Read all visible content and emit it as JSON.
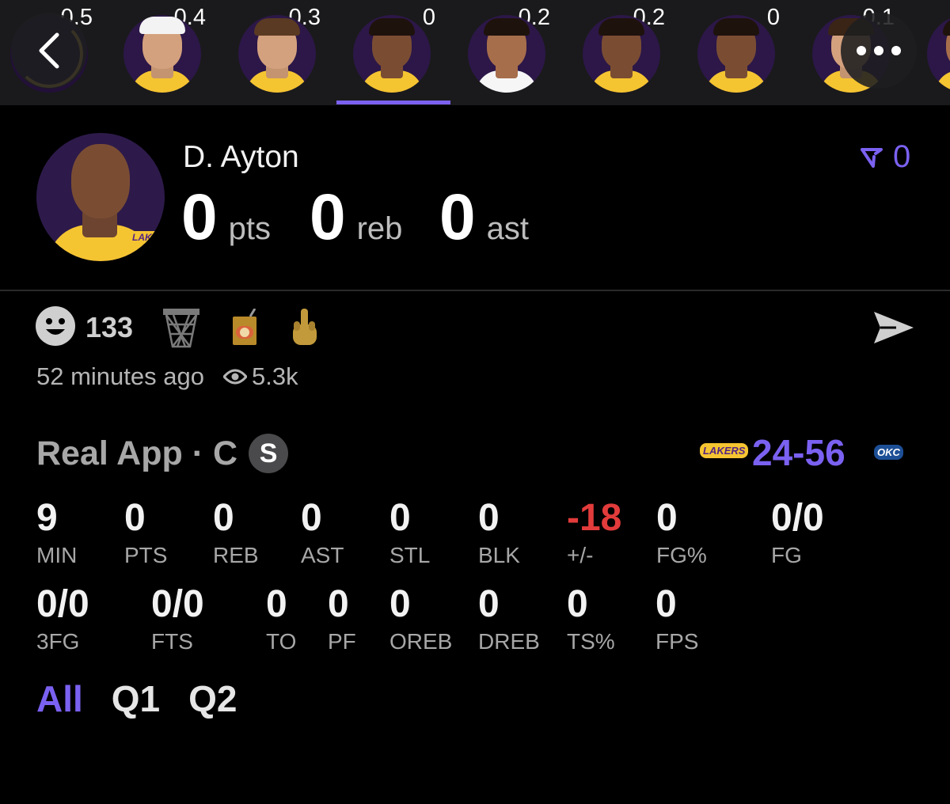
{
  "player_strip": [
    {
      "score": "0.5",
      "style": "ghost"
    },
    {
      "score": "0.4",
      "style": "hat"
    },
    {
      "score": "0.3",
      "style": "light"
    },
    {
      "score": "0",
      "style": "dark",
      "selected": true
    },
    {
      "score": "0.2",
      "style": "mid"
    },
    {
      "score": "0.2",
      "style": "dark"
    },
    {
      "score": "0",
      "style": "dark"
    },
    {
      "score": "-0.1",
      "style": "light"
    },
    {
      "score": "",
      "style": "mid"
    }
  ],
  "header": {
    "player_name": "D. Ayton",
    "pts_value": "0",
    "pts_label": "pts",
    "reb_value": "0",
    "reb_label": "reb",
    "ast_value": "0",
    "ast_label": "ast",
    "vote_count": "0",
    "avatar_logo": "LAKERS"
  },
  "reactions": {
    "count": "133",
    "icons": [
      "smiley-icon",
      "basketball-hoop-icon",
      "juice-box-icon",
      "middle-finger-icon"
    ]
  },
  "meta": {
    "time_ago": "52 minutes ago",
    "views": "5.3k"
  },
  "game": {
    "title": "Real App · C",
    "badge": "S",
    "home_logo": "LAKERS",
    "away_logo": "OKC",
    "score": "24-56"
  },
  "stats_row1": [
    {
      "value": "9",
      "label": "MIN"
    },
    {
      "value": "0",
      "label": "PTS"
    },
    {
      "value": "0",
      "label": "REB"
    },
    {
      "value": "0",
      "label": "AST"
    },
    {
      "value": "0",
      "label": "STL"
    },
    {
      "value": "0",
      "label": "BLK"
    },
    {
      "value": "-18",
      "label": "+/-"
    },
    {
      "value": "0",
      "label": "FG%"
    },
    {
      "value": "0/0",
      "label": "FG"
    }
  ],
  "stats_row2": [
    {
      "value": "0/0",
      "label": "3FG"
    },
    {
      "value": "0/0",
      "label": "FTS"
    },
    {
      "value": "0",
      "label": "TO"
    },
    {
      "value": "0",
      "label": "PF"
    },
    {
      "value": "0",
      "label": "OREB"
    },
    {
      "value": "0",
      "label": "DREB"
    },
    {
      "value": "0",
      "label": "TS%"
    },
    {
      "value": "0",
      "label": "FPS"
    }
  ],
  "tabs": [
    "All",
    "Q1",
    "Q2"
  ],
  "colors": {
    "accent": "#7b61f1",
    "negative": "#e23b3b",
    "lakers_gold": "#f5c431",
    "lakers_purple": "#552583"
  }
}
